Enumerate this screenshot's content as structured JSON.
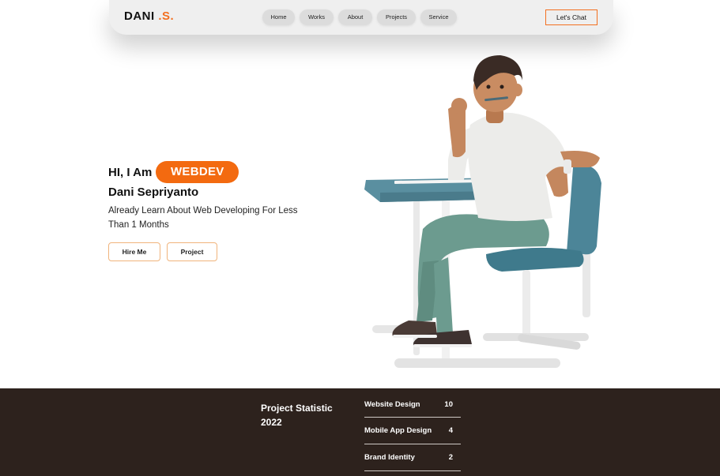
{
  "nav": {
    "logo_main": "DANI ",
    "logo_accent": ".S.",
    "links": [
      "Home",
      "Works",
      "About",
      "Projects",
      "Service"
    ],
    "cta": "Let's Chat"
  },
  "hero": {
    "greeting": "HI, I Am",
    "badge": "WEBDEV",
    "name": "Dani Sepriyanto",
    "tagline": "Already Learn About Web Developing For Less Than 1 Months",
    "buttons": [
      "Hire Me",
      "Project"
    ]
  },
  "stats": {
    "title": "Project Statistic 2022",
    "rows": [
      {
        "label": "Website Design",
        "value": "10"
      },
      {
        "label": "Mobile App Design",
        "value": "4"
      },
      {
        "label": "Brand Identity",
        "value": "2"
      }
    ]
  },
  "colors": {
    "accent": "#f37021",
    "stats_bg": "#2d221d",
    "nav_bg": "#efefef"
  }
}
